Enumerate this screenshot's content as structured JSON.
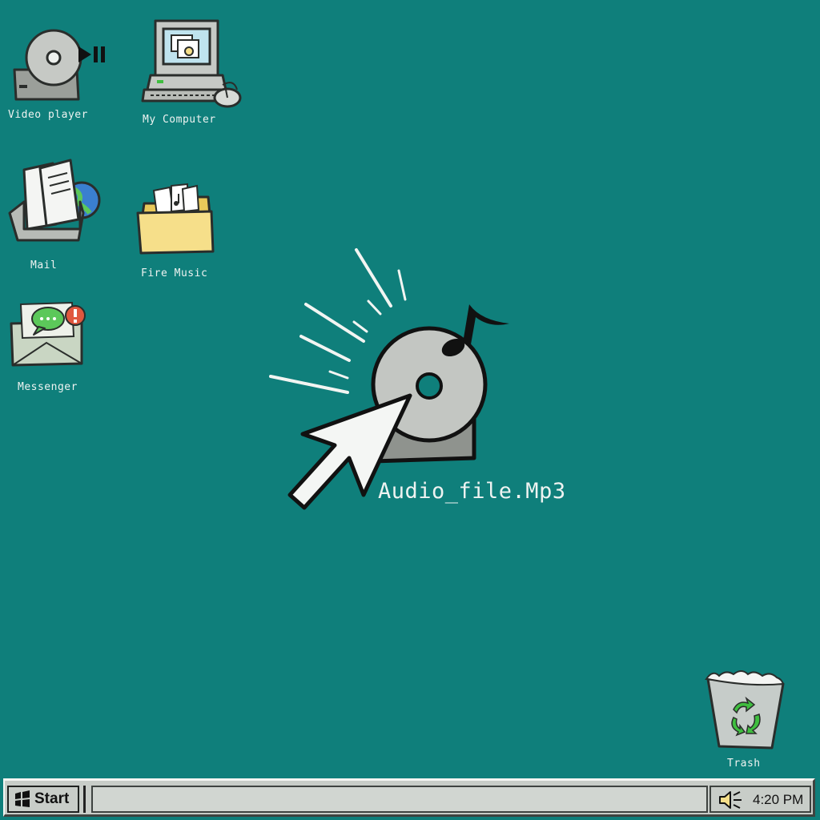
{
  "desktop": {
    "background_color": "#0f7f7b",
    "icons": {
      "video_player": {
        "label": "Video player",
        "icon": "disc-player-icon"
      },
      "my_computer": {
        "label": "My Computer",
        "icon": "computer-icon"
      },
      "mail": {
        "label": "Mail",
        "icon": "mail-icon"
      },
      "fire_music": {
        "label": "Fire Music",
        "icon": "folder-icon"
      },
      "messenger": {
        "label": "Messenger",
        "icon": "messenger-icon"
      },
      "audio_file": {
        "label": "Audio_file.Mp3",
        "icon": "audio-disc-icon"
      },
      "trash": {
        "label": "Trash",
        "icon": "recycle-bin-icon"
      }
    },
    "cursor": "arrow-pointer-icon"
  },
  "taskbar": {
    "start_label": "Start",
    "tray": {
      "volume_icon": "speaker-icon",
      "clock": "4:20 PM"
    }
  },
  "colors": {
    "desktop": "#0f7f7b",
    "taskbar": "#c8cdc8",
    "folder": "#f6df8a",
    "recycle": "#3fbe3f",
    "chat_bubble": "#5cc85a",
    "alert": "#e0573e"
  }
}
